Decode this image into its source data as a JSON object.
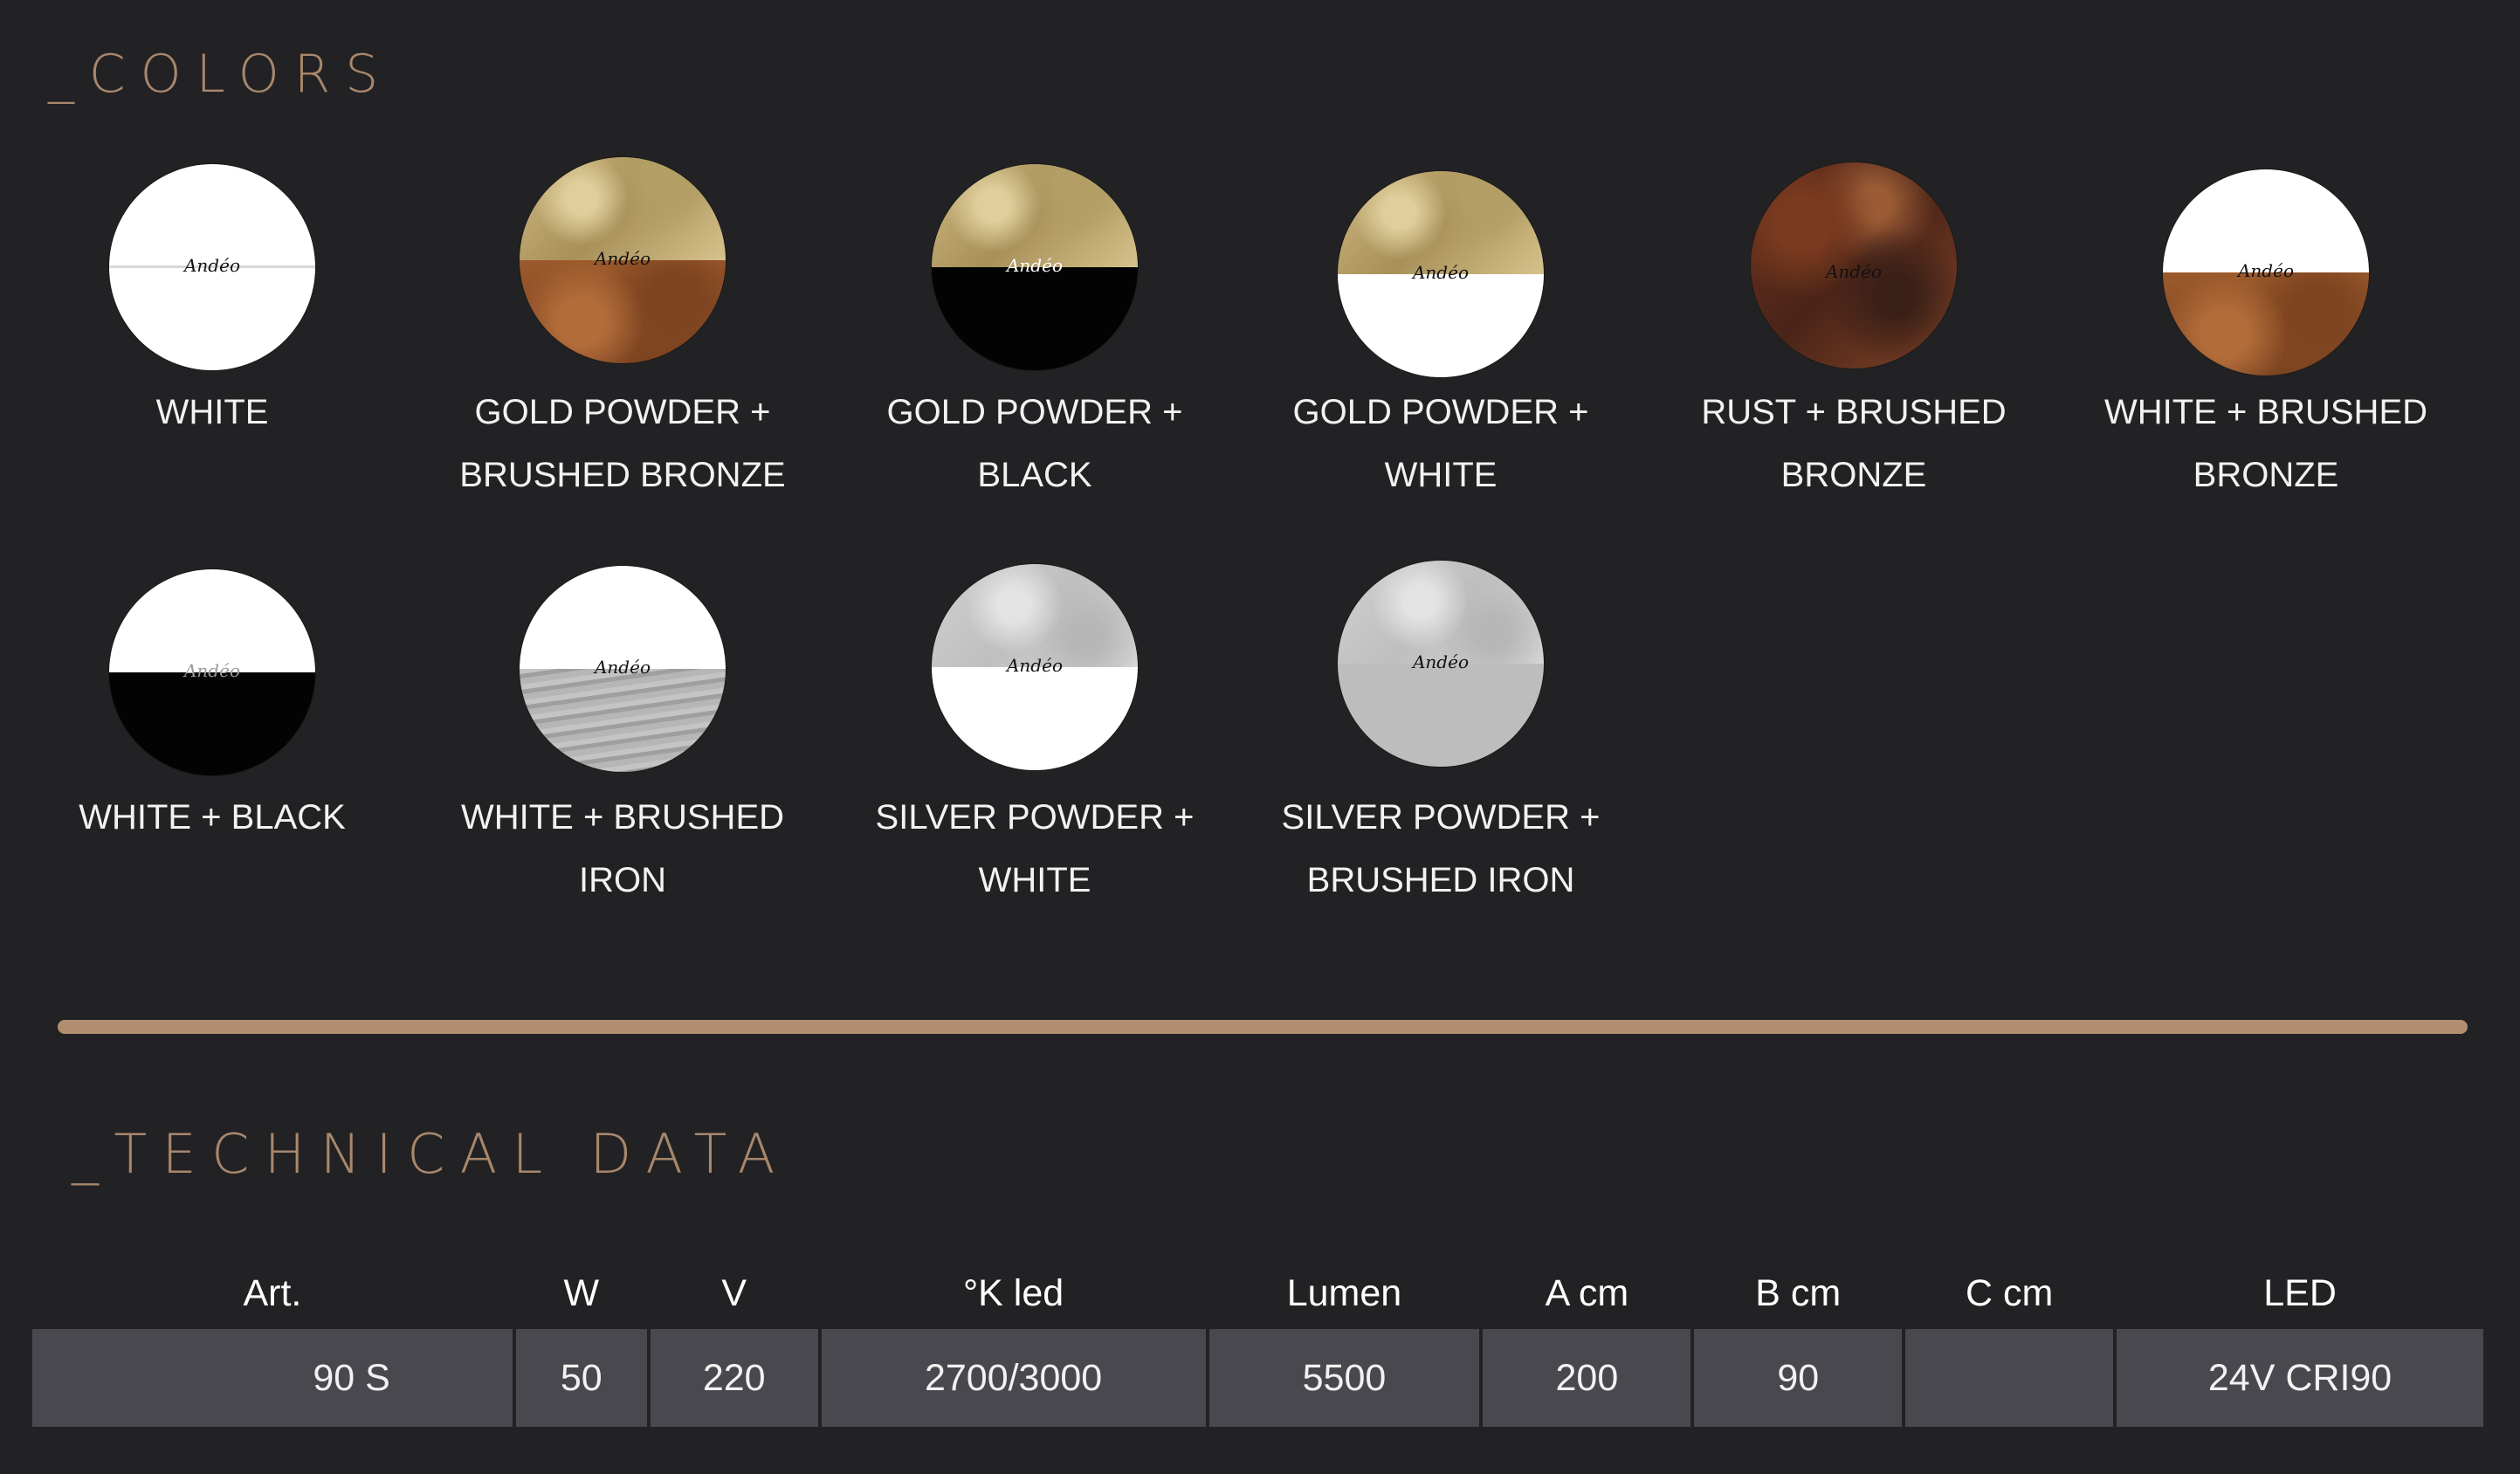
{
  "colors_title": "_COLORS",
  "swatches": [
    {
      "label_line1": "WHITE",
      "label_line2": "",
      "mark": "Andéo"
    },
    {
      "label_line1": "GOLD POWDER +",
      "label_line2": "BRUSHED BRONZE",
      "mark": "Andéo"
    },
    {
      "label_line1": "GOLD POWDER +",
      "label_line2": "BLACK",
      "mark": "Andéo"
    },
    {
      "label_line1": "GOLD POWDER +",
      "label_line2": "WHITE",
      "mark": "Andéo"
    },
    {
      "label_line1": "RUST + BRUSHED",
      "label_line2": "BRONZE",
      "mark": "Andéo"
    },
    {
      "label_line1": "WHITE + BRUSHED",
      "label_line2": "BRONZE",
      "mark": "Andéo"
    },
    {
      "label_line1": "WHITE +  BLACK",
      "label_line2": "",
      "mark": "Andéo"
    },
    {
      "label_line1": "WHITE +  BRUSHED",
      "label_line2": "IRON",
      "mark": "Andéo"
    },
    {
      "label_line1": "SILVER POWDER +",
      "label_line2": "WHITE",
      "mark": "Andéo"
    },
    {
      "label_line1": "SILVER POWDER +",
      "label_line2": "BRUSHED IRON",
      "mark": "Andéo"
    }
  ],
  "technical_title": "_TECHNICAL DATA",
  "table": {
    "headers": [
      "Art.",
      "W",
      "V",
      "°K led",
      "Lumen",
      "A cm",
      "B cm",
      "C cm",
      "LED"
    ],
    "row": [
      "90 S",
      "50",
      "220",
      "2700/3000",
      "5500",
      "200",
      "90",
      "",
      "24V CRI90"
    ]
  },
  "colors": {
    "background": "#222224",
    "accent": "#b28e70",
    "table_cell": "#48484e"
  }
}
